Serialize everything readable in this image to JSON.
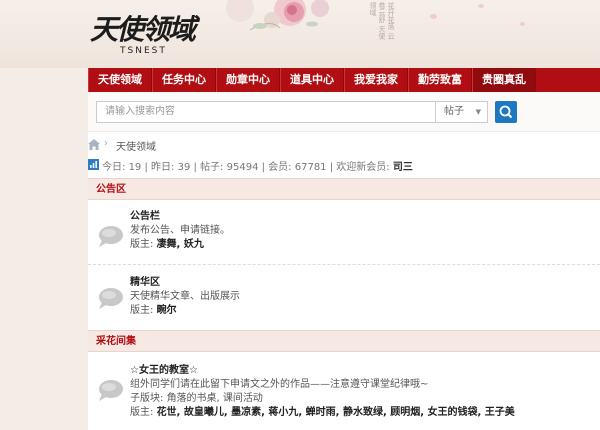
{
  "header": {
    "logo_title": "天使领域",
    "logo_sub": "TSNEST",
    "calligraphy": "花开花落 云卷云舒 天使领域"
  },
  "nav": {
    "items": [
      "天使领域",
      "任务中心",
      "勋章中心",
      "道具中心",
      "我爱我家",
      "勤劳致富",
      "贵圈真乱"
    ]
  },
  "search": {
    "placeholder": "请输入搜索内容",
    "type": "帖子",
    "button": "search-icon"
  },
  "breadcrumb": {
    "home": "home-icon",
    "current": "天使领域"
  },
  "stats": {
    "today_label": "今日:",
    "today": "19",
    "yesterday_label": "昨日:",
    "yesterday": "39",
    "posts_label": "帖子:",
    "posts": "95494",
    "members_label": "会员:",
    "members": "67781",
    "welcome_label": "欢迎新会员:",
    "newest": "司三"
  },
  "sections": [
    {
      "title": "公告区",
      "forums": [
        {
          "name": "公告栏",
          "desc": "发布公告、申请链接。",
          "mods_label": "版主:",
          "mods": "凄舞, 妖九"
        },
        {
          "name": "精华区",
          "desc": "天使精华文章、出版展示",
          "mods_label": "版主:",
          "mods": "畹尔"
        }
      ]
    },
    {
      "title": "采花间集",
      "forums": [
        {
          "name": "☆女王的教室☆",
          "desc": "组外同学们请在此留下申请文之外的作品——注意遵守课堂纪律哦~",
          "sub_label": "子版块:",
          "sub": "角落的书桌, 课间活动",
          "mods_label": "版主:",
          "mods": "花世, 故皇曦儿, 墨凉素, 蒋小九, 蝉时雨, 静水致绿, 顾明烟, 女王的钱袋, 王子美"
        }
      ]
    }
  ],
  "colors": {
    "nav": "#b10e13",
    "section_title": "#b10e13",
    "search_button": "#1d78c2"
  }
}
